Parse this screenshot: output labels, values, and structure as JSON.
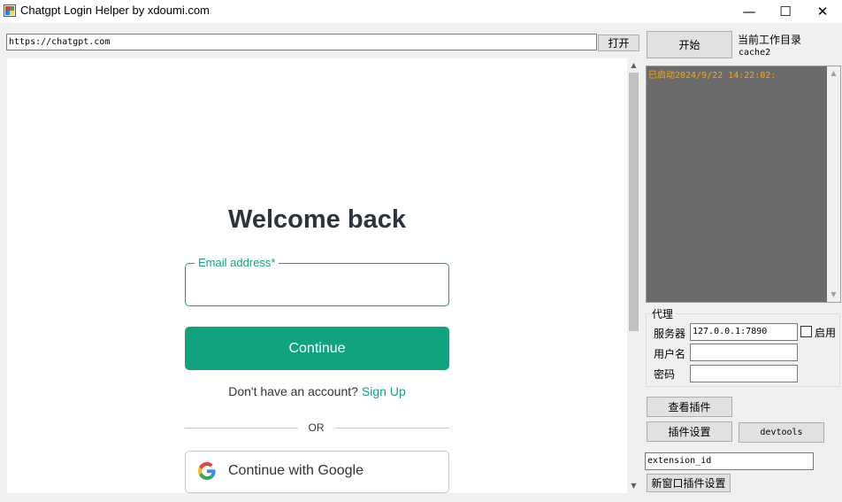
{
  "window": {
    "title": "Chatgpt Login Helper by xdoumi.com",
    "minimize_glyph": "—",
    "maximize_glyph": "☐",
    "close_glyph": "✕"
  },
  "toolbar": {
    "url_value": "https://chatgpt.com",
    "open_label": "打开"
  },
  "browser_page": {
    "heading": "Welcome back",
    "email_label": "Email address*",
    "email_value": "",
    "continue_label": "Continue",
    "no_account_text": "Don't have an account?",
    "signup_link": "Sign Up",
    "or_text": "OR",
    "google_label": "Continue with Google",
    "icons": {
      "google": "google-logo-icon"
    }
  },
  "scrollbars": {
    "up_glyph": "▲",
    "down_glyph": "▼"
  },
  "side_panel": {
    "start_label": "开始",
    "cwd_label": "当前工作目录",
    "cwd_value": "cache2",
    "log_text": "已启动2024/9/22 14:22:02:",
    "proxy": {
      "group_title": "代理",
      "server_label": "服务器",
      "server_value": "127.0.0.1:7890",
      "enable_label": "启用",
      "enabled": false,
      "username_label": "用户名",
      "username_value": "",
      "password_label": "密码",
      "password_value": ""
    },
    "view_plugins_label": "查看插件",
    "plugin_settings_label": "插件设置",
    "devtools_label": "devtools",
    "extension_id_value": "extension_id",
    "new_window_plugin_label": "新窗口插件设置"
  },
  "colors": {
    "accent": "#10a37f",
    "log_background": "#6b6b6b",
    "log_text": "#ffa500",
    "heading": "#2d333a"
  }
}
